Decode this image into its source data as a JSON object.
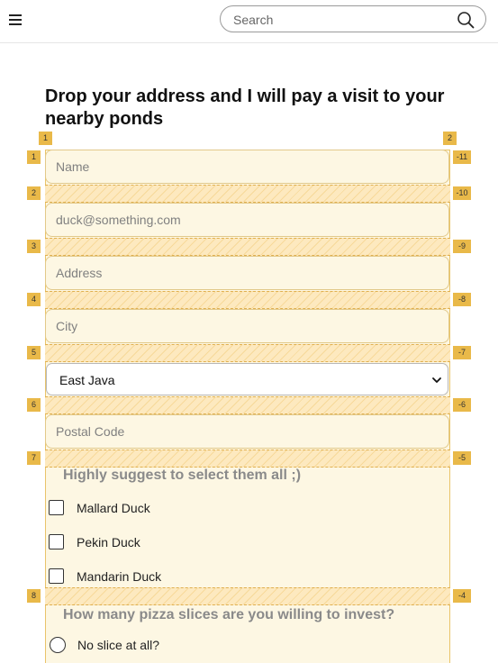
{
  "header": {
    "search": {
      "placeholder": "Search",
      "icon": "search-icon"
    },
    "menu_icon": "hamburger-menu-icon"
  },
  "title": "Drop your address and I will pay a visit to your nearby ponds",
  "grid": {
    "left_tags": [
      "1",
      "1",
      "2",
      "3",
      "4",
      "5",
      "6",
      "7",
      "8"
    ],
    "right_tags": [
      "2",
      "-11",
      "-10",
      "-9",
      "-8",
      "-7",
      "-6",
      "-5",
      "-4"
    ],
    "colors": {
      "fill": "#fdf7e3",
      "gap_stripe": "#f7d99a",
      "tag": "#e9b949"
    }
  },
  "form": {
    "name_placeholder": "Name",
    "email_placeholder": "duck@something.com",
    "address_placeholder": "Address",
    "city_placeholder": "City",
    "province_selected": "East Java",
    "postal_placeholder": "Postal Code",
    "ducks_label": "Highly suggest to select them all ;)",
    "ducks": [
      "Mallard Duck",
      "Pekin Duck",
      "Mandarin Duck"
    ],
    "pizza_label": "How many pizza slices are you willing to invest?",
    "pizza_options": [
      "No slice at all?"
    ]
  }
}
